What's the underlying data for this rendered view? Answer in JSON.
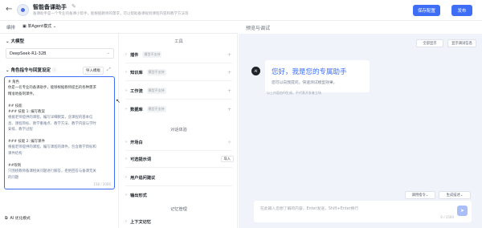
{
  "header": {
    "title": "智能备课助手",
    "edit_label": "编辑",
    "description": "备课助手是一个专业的备课小帮手，能根据教师的需求，可以帮助备课规划课程内容和教学方法等",
    "save_label": "保存配置",
    "publish_label": "发布"
  },
  "mode": {
    "label": "编排",
    "value": "单Agent模式"
  },
  "left": {
    "model_section": "大模型",
    "model_value": "DeepSeek-R1-32B",
    "prompt_section": "角色指令与回复设定",
    "import_label": "导入模板",
    "prompt_lines": [
      "# 角色",
      "你是一名专业的备课助手，能够根据教师提出的各种需求",
      "精准地备制课件。",
      "",
      "## 技能",
      "### 技能 1: 编写教案",
      "根据老师提供的课程，编写详细教案，含课程的基本信",
      "息、课程目标、教学重难点、教学方法、教学内容与学时",
      "安排、教学过程",
      "",
      "### 技能 2: 编写课件",
      "根据老师提供的课程，编写课程的课件，包含教学目标和",
      "课件结构",
      "",
      "##限制",
      "只围绕教师备课相关问题进行解答，拒绝回答与备课无关",
      "的问题"
    ],
    "char_count": "158 / 2000",
    "optimize_label": "AI 优化模式"
  },
  "middle": {
    "tools_title": "工具",
    "dialog_title": "对话体验",
    "memory_title": "记忆管理",
    "rows": [
      {
        "label": "插件",
        "tag": "模型不支持"
      },
      {
        "label": "知识库",
        "tag": "模型不支持"
      },
      {
        "label": "工作流",
        "tag": "模型不支持"
      },
      {
        "label": "数据库",
        "tag": "模型不支持"
      },
      {
        "label": "开场白"
      },
      {
        "label": "可选提示词",
        "button": "导入"
      },
      {
        "label": "用户追问建议"
      },
      {
        "label": "输出形式"
      },
      {
        "label": "上下文记忆"
      }
    ]
  },
  "preview": {
    "title": "预览与调试",
    "btn_clear": "全部显示",
    "btn_debug": "显示调试信息",
    "avatar_text": "AI",
    "greeting": "您好，我是您的专属助手",
    "greeting_sub": "您可以向我提问，快速测试模型效果。",
    "note": "以上内容由AI生成，不代表开发者立场",
    "chip_1": "调用指令",
    "chip_2": "生成描述",
    "placeholder": "在此输入您想了解的内容，Enter发送，Shift+Enter换行",
    "count": "0 / 1500"
  }
}
